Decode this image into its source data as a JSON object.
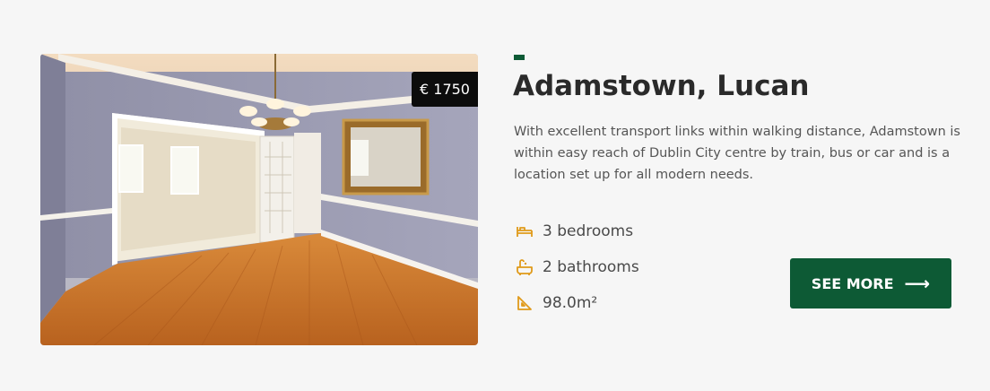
{
  "listing": {
    "price": "€ 1750",
    "title": "Adamstown, Lucan",
    "description": "With excellent transport links within walking distance, Adamstown is within easy reach of Dublin City centre by train, bus or car and is a location set up for all modern needs.",
    "features": [
      {
        "icon": "bed-icon",
        "text": "3 bedrooms"
      },
      {
        "icon": "bathtub-icon",
        "text": "2 bathrooms"
      },
      {
        "icon": "set-square-icon",
        "text": "98.0m²"
      }
    ],
    "cta_label": "SEE MORE",
    "cta_icon": "arrow-right-icon"
  },
  "colors": {
    "accent_green": "#0d5a35",
    "icon_orange": "#e09a1a",
    "background": "#f6f6f6",
    "price_badge": "#0c0c0c"
  }
}
